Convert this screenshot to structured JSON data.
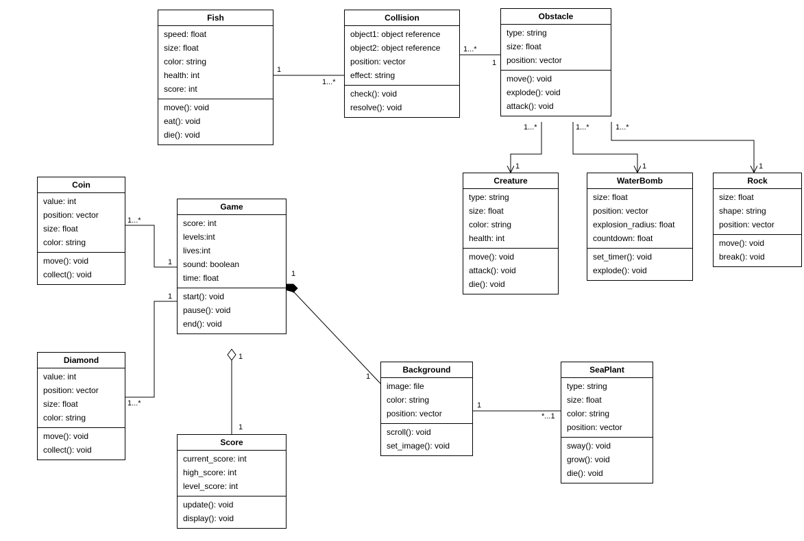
{
  "classes": {
    "Fish": {
      "name": "Fish",
      "attrs": [
        "speed: float",
        "size: float",
        "color: string",
        "health: int",
        "score: int"
      ],
      "ops": [
        "move(): void",
        "eat(): void",
        "die(): void"
      ]
    },
    "Collision": {
      "name": "Collision",
      "attrs": [
        "object1: object reference",
        "object2: object reference",
        "position: vector",
        "effect: string"
      ],
      "ops": [
        "check(): void",
        "resolve(): void"
      ]
    },
    "Obstacle": {
      "name": "Obstacle",
      "attrs": [
        "type: string",
        "size: float",
        "position: vector"
      ],
      "ops": [
        "move(): void",
        "explode(): void",
        "attack(): void"
      ]
    },
    "Coin": {
      "name": "Coin",
      "attrs": [
        "value: int",
        "position: vector",
        "size: float",
        "color: string"
      ],
      "ops": [
        "move(): void",
        "collect(): void"
      ]
    },
    "Game": {
      "name": "Game",
      "attrs": [
        "score: int",
        "levels:int",
        "lives:int",
        "sound: boolean",
        "time: float"
      ],
      "ops": [
        "start(): void",
        "pause(): void",
        "end(): void"
      ]
    },
    "Creature": {
      "name": "Creature",
      "attrs": [
        "type: string",
        "size: float",
        "color: string",
        "health: int"
      ],
      "ops": [
        "move(): void",
        "attack(): void",
        "die(): void"
      ]
    },
    "WaterBomb": {
      "name": "WaterBomb",
      "attrs": [
        "size: float",
        "position: vector",
        "explosion_radius: float",
        "countdown: float"
      ],
      "ops": [
        "set_timer(): void",
        "explode(): void"
      ]
    },
    "Rock": {
      "name": "Rock",
      "attrs": [
        "size: float",
        "shape: string",
        "position: vector"
      ],
      "ops": [
        "move(): void",
        "break(): void"
      ]
    },
    "Diamond": {
      "name": "Diamond",
      "attrs": [
        "value: int",
        "position: vector",
        "size: float",
        "color: string"
      ],
      "ops": [
        "move(): void",
        "collect(): void"
      ]
    },
    "Score": {
      "name": "Score",
      "attrs": [
        "current_score: int",
        "high_score: int",
        "level_score: int"
      ],
      "ops": [
        "update(): void",
        "display(): void"
      ]
    },
    "Background": {
      "name": "Background",
      "attrs": [
        "image: file",
        "color: string",
        "position: vector"
      ],
      "ops": [
        "scroll(): void",
        "set_image(): void"
      ]
    },
    "SeaPlant": {
      "name": "SeaPlant",
      "attrs": [
        "type: string",
        "size: float",
        "color: string",
        "position: vector"
      ],
      "ops": [
        "sway(): void",
        "grow(): void",
        "die(): void"
      ]
    }
  },
  "mult": {
    "fish_collision_1": "1",
    "fish_collision_many": "1...*",
    "collision_obstacle_many": "1...*",
    "collision_obstacle_1": "1",
    "obstacle_creature_many": "1...*",
    "obstacle_creature_1": "1",
    "obstacle_waterbomb_many": "1...*",
    "obstacle_waterbomb_1": "1",
    "obstacle_rock_many": "1...*",
    "obstacle_rock_1": "1",
    "coin_game_many": "1...*",
    "coin_game_1": "1",
    "diamond_game_many": "1...*",
    "diamond_game_1": "1",
    "game_score_top": "1",
    "game_score_bottom": "1",
    "game_bg_1a": "1",
    "game_bg_1b": "1",
    "bg_seaplant_1": "1",
    "bg_seaplant_many": "*...1"
  }
}
